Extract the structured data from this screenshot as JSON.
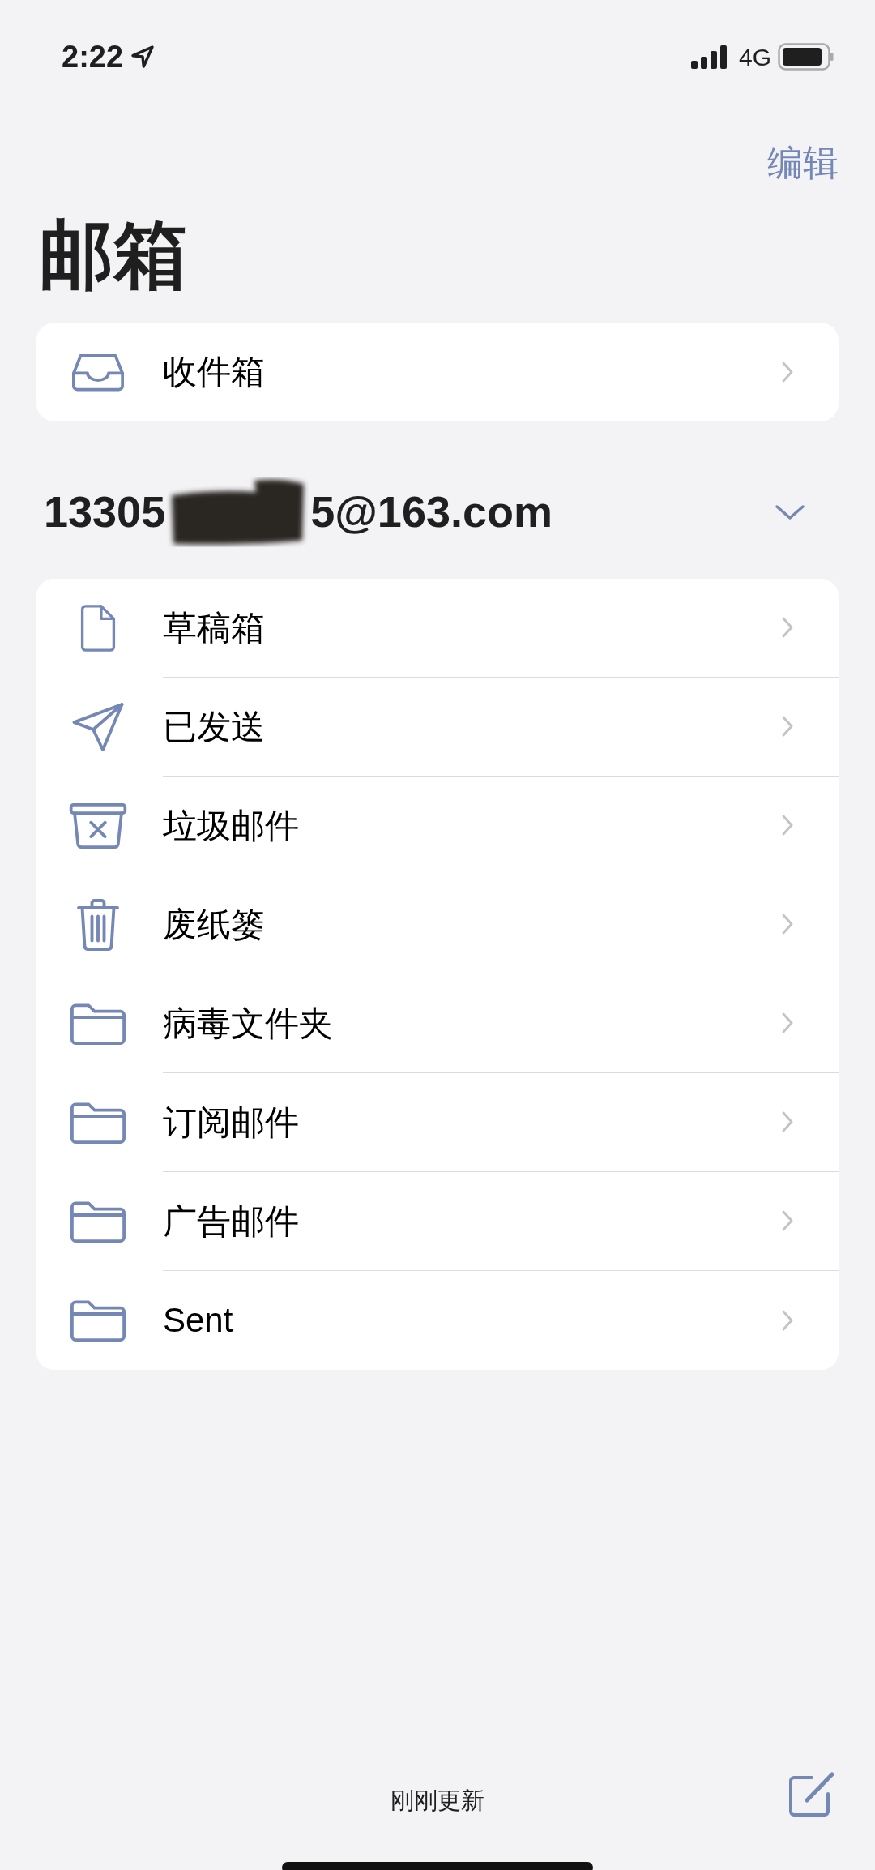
{
  "status_bar": {
    "time": "2:22",
    "network": "4G"
  },
  "nav": {
    "edit": "编辑"
  },
  "title": "邮箱",
  "top_list": [
    {
      "label": "收件箱",
      "kind": "inbox"
    }
  ],
  "account": {
    "email_start": "13305",
    "email_end": "5@163.com",
    "expanded": true
  },
  "folders": [
    {
      "label": "草稿箱",
      "kind": "document"
    },
    {
      "label": "已发送",
      "kind": "send"
    },
    {
      "label": "垃圾邮件",
      "kind": "junk"
    },
    {
      "label": "废纸篓",
      "kind": "trash"
    },
    {
      "label": "病毒文件夹",
      "kind": "folder"
    },
    {
      "label": "订阅邮件",
      "kind": "folder"
    },
    {
      "label": "广告邮件",
      "kind": "folder"
    },
    {
      "label": "Sent",
      "kind": "folder"
    }
  ],
  "toolbar": {
    "status": "刚刚更新"
  }
}
